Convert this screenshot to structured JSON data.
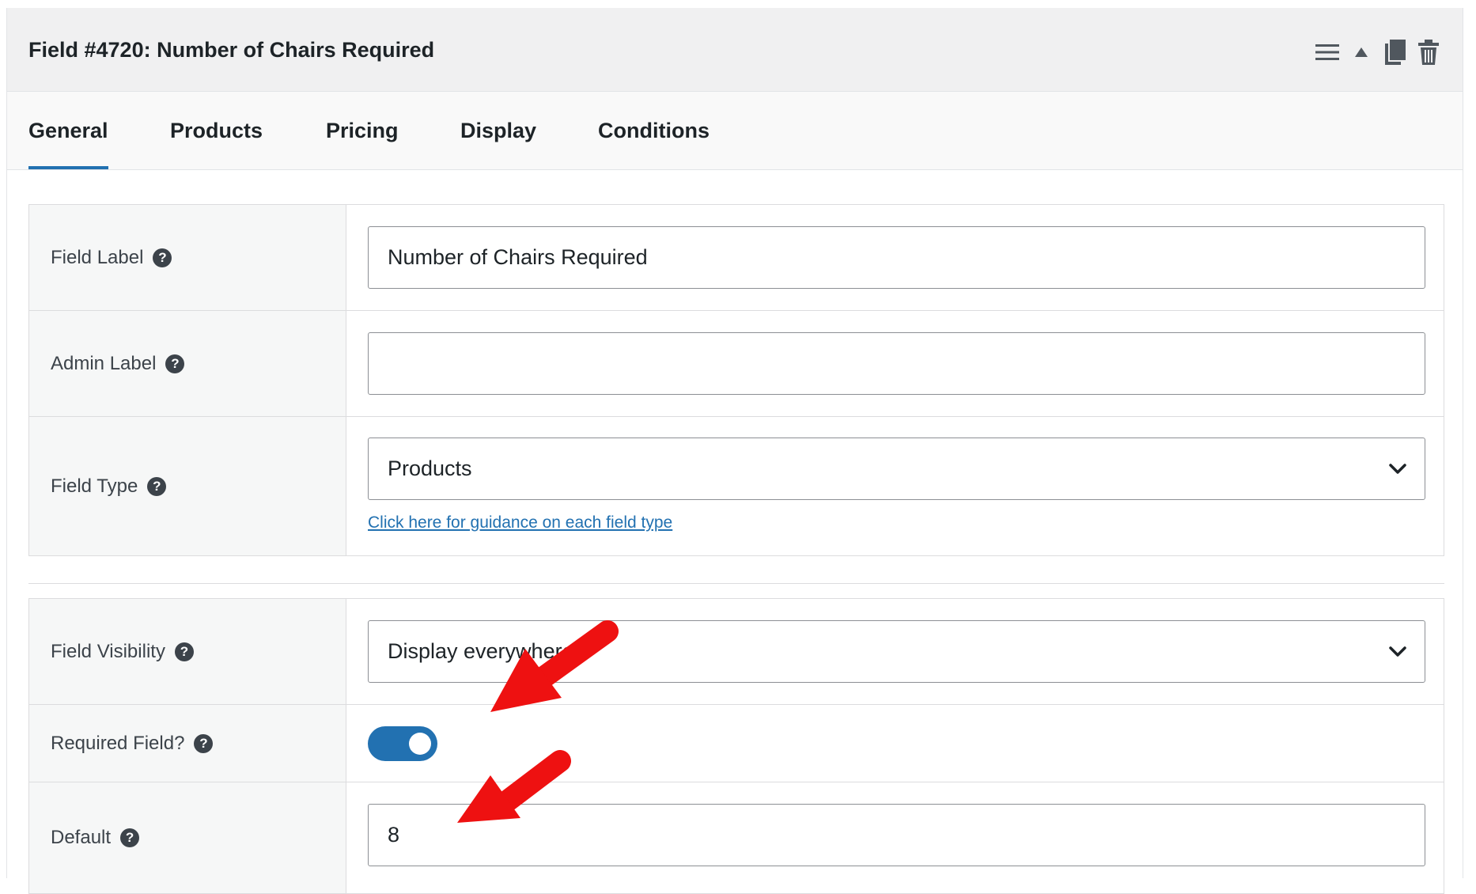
{
  "header": {
    "title": "Field #4720: Number of Chairs Required",
    "tools": [
      "menu-icon",
      "collapse-up-icon",
      "duplicate-icon",
      "trash-icon"
    ]
  },
  "tabs": [
    {
      "label": "General",
      "active": true
    },
    {
      "label": "Products",
      "active": false
    },
    {
      "label": "Pricing",
      "active": false
    },
    {
      "label": "Display",
      "active": false
    },
    {
      "label": "Conditions",
      "active": false
    }
  ],
  "general": {
    "field_label": {
      "label": "Field Label",
      "value": "Number of Chairs Required"
    },
    "admin_label": {
      "label": "Admin Label",
      "value": ""
    },
    "field_type": {
      "label": "Field Type",
      "selected": "Products",
      "guidance_link": "Click here for guidance on each field type"
    },
    "field_visibility": {
      "label": "Field Visibility",
      "selected": "Display everywhere"
    },
    "required_field": {
      "label": "Required Field?",
      "enabled": true
    },
    "default": {
      "label": "Default",
      "value": "8"
    }
  },
  "colors": {
    "accent": "#2271b1",
    "annotation_arrow": "#ee1111",
    "header_bg": "#f0f0f1",
    "label_bg": "#f6f7f7"
  }
}
